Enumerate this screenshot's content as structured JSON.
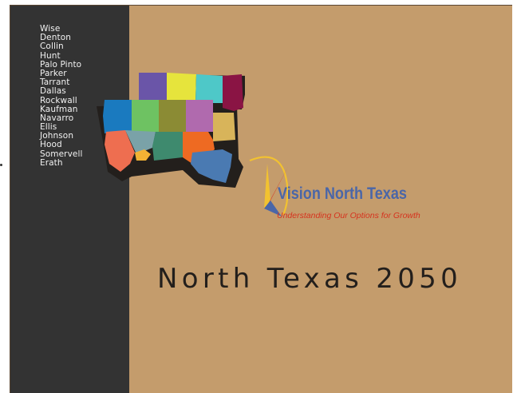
{
  "slide": {
    "title": "North Texas 2050",
    "background_color": "#c49c6c",
    "sidebar_color": "#333333"
  },
  "sidebar": {
    "counties": [
      "Wise",
      "Denton",
      "Collin",
      "Hunt",
      "Palo Pinto",
      "Parker",
      "Tarrant",
      "Dallas",
      "Rockwall",
      "Kaufman",
      "Navarro",
      "Ellis",
      "Johnson",
      "Hood",
      "Somervell",
      "Erath"
    ]
  },
  "logo": {
    "title": "Vision North Texas",
    "tagline": "Understanding Our Options for Growth",
    "title_color": "#4a66a8",
    "tagline_color": "#d6321e",
    "compass_colors": [
      "#f2c230",
      "#d6321e",
      "#4a66a8"
    ]
  },
  "map": {
    "region_colors": {
      "Wise": "#6a55a8",
      "Denton": "#e6e43c",
      "Collin": "#4ec8c8",
      "Hunt": "#8a1444",
      "Palo Pinto": "#1a7abf",
      "Parker": "#6ec262",
      "Tarrant": "#8b8b34",
      "Dallas": "#b06aae",
      "Rockwall": "#d8b45a",
      "Erath": "#ee6e50",
      "Hood": "#7aa2a8",
      "Somervell": "#f2b234",
      "Johnson": "#3e8a6e",
      "Ellis": "#ee6a22",
      "Navarro": "#4a7ab2",
      "Kaufman": "#d8b45a"
    }
  }
}
